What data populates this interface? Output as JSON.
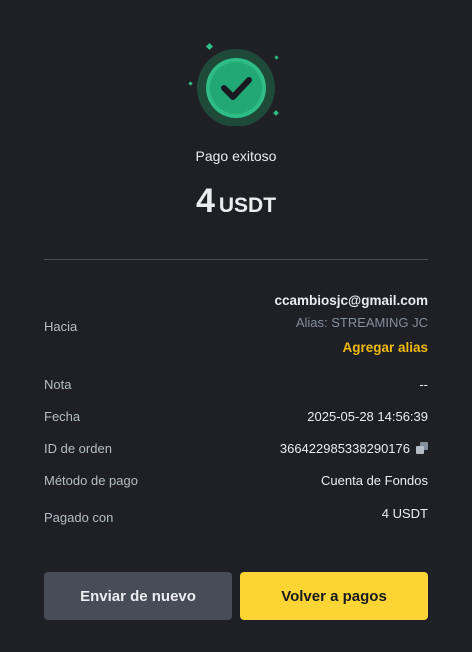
{
  "status": {
    "title": "Pago exitoso",
    "amount_value": "4",
    "amount_unit": "USDT",
    "icon": "check-circle-icon"
  },
  "details": {
    "to": {
      "label": "Hacia",
      "email": "ccambiosjc@gmail.com",
      "alias": "Alias: STREAMING JC",
      "add_alias": "Agregar alias"
    },
    "note": {
      "label": "Nota",
      "value": "--"
    },
    "date": {
      "label": "Fecha",
      "value": "2025-05-28 14:56:39"
    },
    "order_id": {
      "label": "ID de orden",
      "value": "366422985338290176",
      "icon": "copy-icon"
    },
    "payment_method": {
      "label": "Método de pago",
      "value": "Cuenta de Fondos"
    },
    "paid_with": {
      "label": "Pagado con",
      "value": "4 USDT"
    }
  },
  "actions": {
    "send_again": "Enviar de nuevo",
    "back_to_payments": "Volver a pagos"
  },
  "colors": {
    "background": "#1e2026",
    "accent_yellow": "#fcd535",
    "link_yellow": "#f0b90b",
    "success_green": "#2ebd85",
    "secondary_button": "#474d57"
  }
}
